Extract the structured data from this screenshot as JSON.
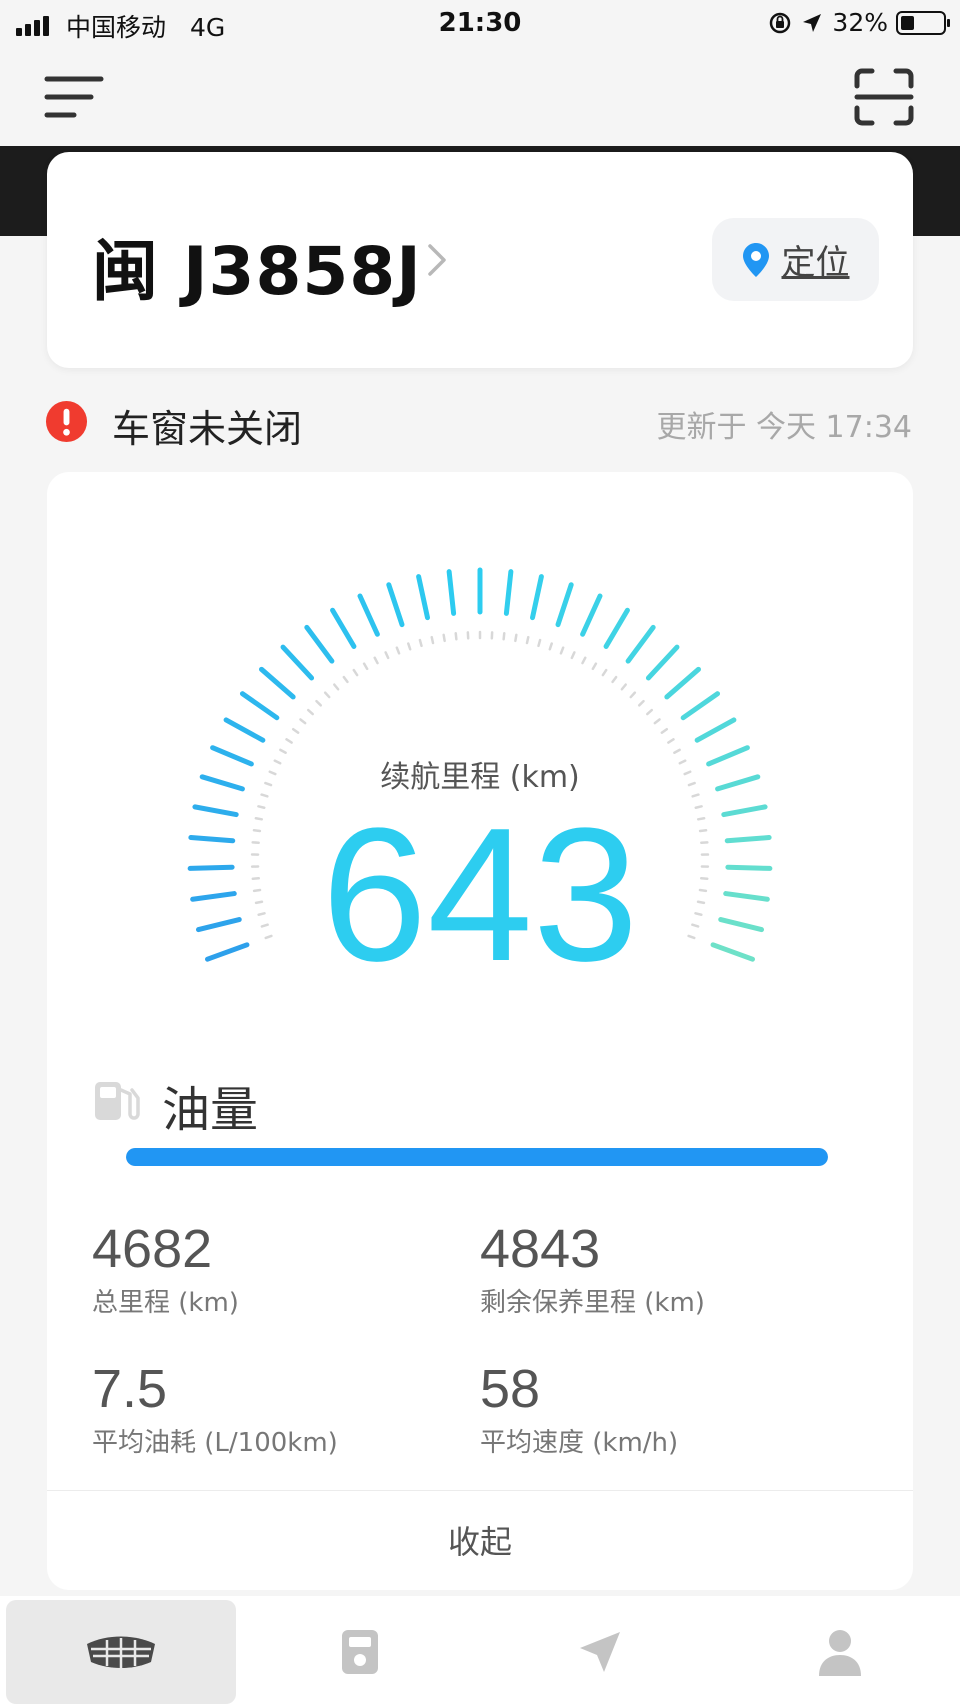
{
  "status_bar": {
    "carrier": "中国移动",
    "network": "4G",
    "time": "21:30",
    "battery": "32%",
    "battery_level": 0.32
  },
  "vehicle": {
    "plate": "闽 J3858J",
    "locate_label": "定位"
  },
  "alert": {
    "message": "车窗未关闭",
    "updated": "更新于 今天 17:34",
    "color": "#f03b2f"
  },
  "range": {
    "label": "续航里程 (km)",
    "value": "643",
    "color": "#2dcdf0"
  },
  "fuel": {
    "label": "油量",
    "level": 1.0,
    "color": "#2196f3"
  },
  "stats": [
    {
      "value": "4682",
      "label": "总里程 (km)"
    },
    {
      "value": "4843",
      "label": "剩余保养里程 (km)"
    },
    {
      "value": "7.5",
      "label": "平均油耗 (L/100km)"
    },
    {
      "value": "58",
      "label": "平均速度 (km/h)"
    }
  ],
  "collapse_label": "收起",
  "tabs": [
    {
      "icon": "brand-logo-icon",
      "active": true
    },
    {
      "icon": "fuel-pump-icon",
      "active": false
    },
    {
      "icon": "navigation-icon",
      "active": false
    },
    {
      "icon": "user-icon",
      "active": false
    }
  ]
}
